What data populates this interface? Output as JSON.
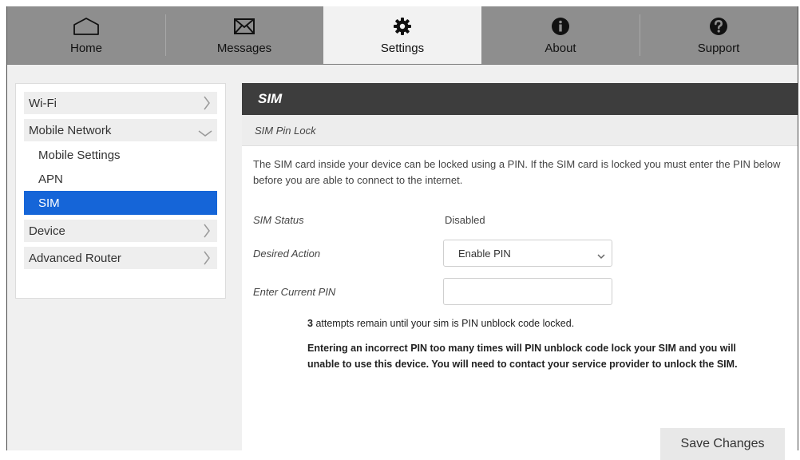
{
  "nav": {
    "tabs": [
      {
        "label": "Home",
        "icon": "home-icon"
      },
      {
        "label": "Messages",
        "icon": "envelope-icon"
      },
      {
        "label": "Settings",
        "icon": "gear-icon"
      },
      {
        "label": "About",
        "icon": "info-icon"
      },
      {
        "label": "Support",
        "icon": "question-icon"
      }
    ],
    "active": "Settings"
  },
  "sidebar": {
    "items": [
      {
        "label": "Wi-Fi",
        "icon": "chevron-right-icon"
      },
      {
        "label": "Mobile Network",
        "icon": "chevron-down-icon",
        "children": [
          "Mobile Settings",
          "APN",
          "SIM"
        ]
      },
      {
        "label": "Device",
        "icon": "chevron-right-icon"
      },
      {
        "label": "Advanced Router",
        "icon": "chevron-right-icon"
      }
    ],
    "active_child": "SIM"
  },
  "panel": {
    "title": "SIM",
    "section": "SIM Pin Lock",
    "description": "The SIM card inside your device can be locked using a PIN. If the SIM card is locked you must enter the PIN below before you are able to connect to the internet.",
    "sim_status_label": "SIM Status",
    "sim_status_value": "Disabled",
    "desired_action_label": "Desired Action",
    "desired_action_value": "Enable PIN",
    "current_pin_label": "Enter Current PIN",
    "current_pin_value": "",
    "attempts_count": "3",
    "attempts_text": "attempts remain until your sim is PIN unblock code locked.",
    "warning": "Entering an incorrect PIN too many times will PIN unblock code lock your SIM and you will unable to use this device. You will need to contact your service provider to unlock the SIM.",
    "save_label": "Save Changes"
  },
  "colors": {
    "nav_bg": "#8e8e8e",
    "active_tab_bg": "#f2f2f2",
    "header_bg": "#3d3d3d",
    "selected_item": "#1565d8"
  }
}
